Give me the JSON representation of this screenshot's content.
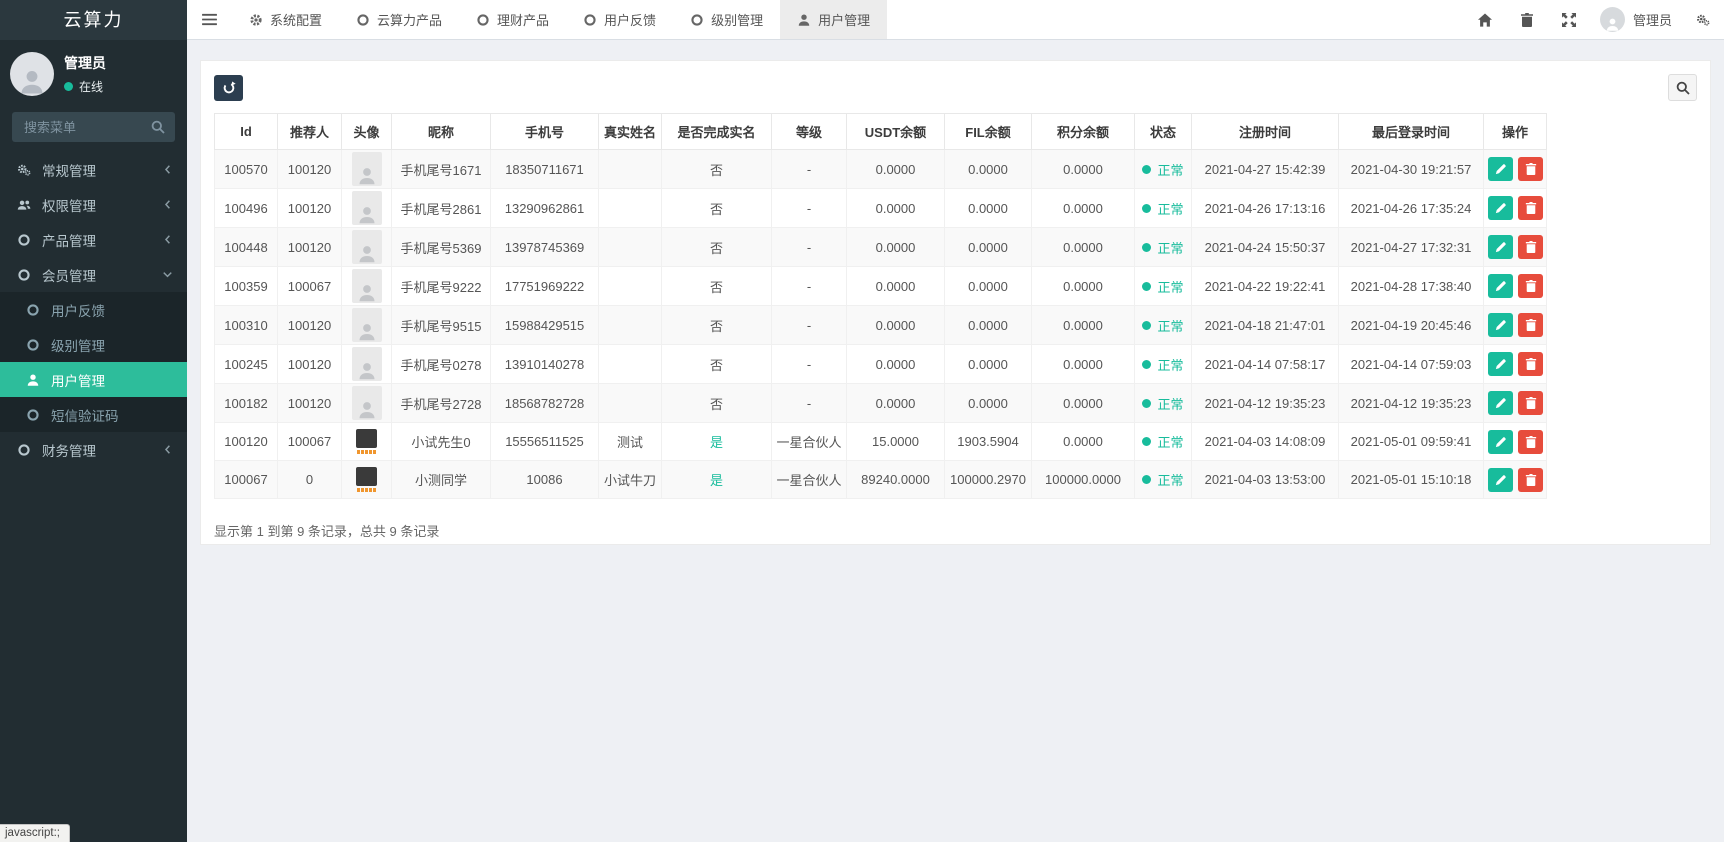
{
  "colors": {
    "accent": "#18bc9c",
    "sidebar_active": "#2dbd9b",
    "danger": "#e74c3c",
    "primary_btn": "#2c3e50"
  },
  "brand": {
    "title": "云算力"
  },
  "sidebar": {
    "user": {
      "name": "管理员",
      "status": "在线"
    },
    "search_placeholder": "搜索菜单",
    "menu": [
      {
        "key": "general",
        "label": "常规管理",
        "icon": "gears",
        "chevron": "left"
      },
      {
        "key": "permission",
        "label": "权限管理",
        "icon": "users",
        "chevron": "left"
      },
      {
        "key": "product",
        "label": "产品管理",
        "icon": "circle",
        "chevron": "left"
      },
      {
        "key": "member",
        "label": "会员管理",
        "icon": "circle",
        "chevron": "down"
      },
      {
        "key": "feedback",
        "label": "用户反馈",
        "icon": "circle",
        "submenu": true
      },
      {
        "key": "level",
        "label": "级别管理",
        "icon": "circle",
        "submenu": true
      },
      {
        "key": "user",
        "label": "用户管理",
        "icon": "user",
        "submenu": true,
        "active": true
      },
      {
        "key": "sms",
        "label": "短信验证码",
        "icon": "circle",
        "submenu": true
      },
      {
        "key": "finance",
        "label": "财务管理",
        "icon": "circle",
        "chevron": "left"
      }
    ]
  },
  "navbar": {
    "tabs": [
      {
        "key": "system-config",
        "label": "系统配置",
        "icon": "gear"
      },
      {
        "key": "cloud-product",
        "label": "云算力产品",
        "icon": "circle"
      },
      {
        "key": "wealth-product",
        "label": "理财产品",
        "icon": "circle"
      },
      {
        "key": "feedback",
        "label": "用户反馈",
        "icon": "circle"
      },
      {
        "key": "level",
        "label": "级别管理",
        "icon": "circle"
      },
      {
        "key": "user",
        "label": "用户管理",
        "icon": "user",
        "active": true
      }
    ],
    "user_label": "管理员"
  },
  "table": {
    "columns": [
      "Id",
      "推荐人",
      "头像",
      "昵称",
      "手机号",
      "真实姓名",
      "是否完成实名",
      "等级",
      "USDT余额",
      "FIL余额",
      "积分余额",
      "状态",
      "注册时间",
      "最后登录时间",
      "操作"
    ],
    "rows": [
      {
        "id": "100570",
        "referrer": "100120",
        "avatar": "placeholder",
        "nickname": "手机尾号1671",
        "phone": "18350711671",
        "realname": "",
        "verified": "否",
        "level": "-",
        "usdt": "0.0000",
        "fil": "0.0000",
        "points": "0.0000",
        "status": "正常",
        "reg": "2021-04-27 15:42:39",
        "last": "2021-04-30 19:21:57"
      },
      {
        "id": "100496",
        "referrer": "100120",
        "avatar": "placeholder",
        "nickname": "手机尾号2861",
        "phone": "13290962861",
        "realname": "",
        "verified": "否",
        "level": "-",
        "usdt": "0.0000",
        "fil": "0.0000",
        "points": "0.0000",
        "status": "正常",
        "reg": "2021-04-26 17:13:16",
        "last": "2021-04-26 17:35:24"
      },
      {
        "id": "100448",
        "referrer": "100120",
        "avatar": "placeholder",
        "nickname": "手机尾号5369",
        "phone": "13978745369",
        "realname": "",
        "verified": "否",
        "level": "-",
        "usdt": "0.0000",
        "fil": "0.0000",
        "points": "0.0000",
        "status": "正常",
        "reg": "2021-04-24 15:50:37",
        "last": "2021-04-27 17:32:31"
      },
      {
        "id": "100359",
        "referrer": "100067",
        "avatar": "placeholder",
        "nickname": "手机尾号9222",
        "phone": "17751969222",
        "realname": "",
        "verified": "否",
        "level": "-",
        "usdt": "0.0000",
        "fil": "0.0000",
        "points": "0.0000",
        "status": "正常",
        "reg": "2021-04-22 19:22:41",
        "last": "2021-04-28 17:38:40"
      },
      {
        "id": "100310",
        "referrer": "100120",
        "avatar": "placeholder",
        "nickname": "手机尾号9515",
        "phone": "15988429515",
        "realname": "",
        "verified": "否",
        "level": "-",
        "usdt": "0.0000",
        "fil": "0.0000",
        "points": "0.0000",
        "status": "正常",
        "reg": "2021-04-18 21:47:01",
        "last": "2021-04-19 20:45:46"
      },
      {
        "id": "100245",
        "referrer": "100120",
        "avatar": "placeholder",
        "nickname": "手机尾号0278",
        "phone": "13910140278",
        "realname": "",
        "verified": "否",
        "level": "-",
        "usdt": "0.0000",
        "fil": "0.0000",
        "points": "0.0000",
        "status": "正常",
        "reg": "2021-04-14 07:58:17",
        "last": "2021-04-14 07:59:03"
      },
      {
        "id": "100182",
        "referrer": "100120",
        "avatar": "placeholder",
        "nickname": "手机尾号2728",
        "phone": "18568782728",
        "realname": "",
        "verified": "否",
        "level": "-",
        "usdt": "0.0000",
        "fil": "0.0000",
        "points": "0.0000",
        "status": "正常",
        "reg": "2021-04-12 19:35:23",
        "last": "2021-04-12 19:35:23"
      },
      {
        "id": "100120",
        "referrer": "100067",
        "avatar": "photo",
        "nickname": "小试先生0",
        "phone": "15556511525",
        "realname": "测试",
        "verified": "是",
        "level": "一星合伙人",
        "usdt": "15.0000",
        "fil": "1903.5904",
        "points": "0.0000",
        "status": "正常",
        "reg": "2021-04-03 14:08:09",
        "last": "2021-05-01 09:59:41"
      },
      {
        "id": "100067",
        "referrer": "0",
        "avatar": "photo",
        "nickname": "小测同学",
        "phone": "10086",
        "realname": "小试牛刀",
        "verified": "是",
        "level": "一星合伙人",
        "usdt": "89240.0000",
        "fil": "100000.2970",
        "points": "100000.0000",
        "status": "正常",
        "reg": "2021-04-03 13:53:00",
        "last": "2021-05-01 15:10:18"
      }
    ]
  },
  "summary": "显示第 1 到第 9 条记录，总共 9 条记录",
  "statusbar": "javascript:;"
}
